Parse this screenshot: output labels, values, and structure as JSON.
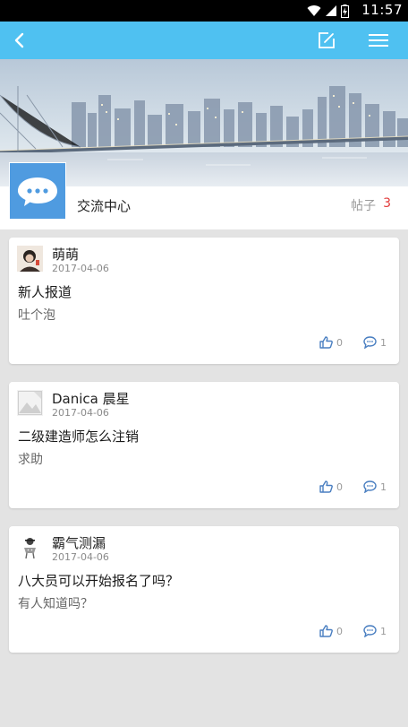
{
  "status_bar": {
    "time": "11:57"
  },
  "toolbar": {
    "back_icon": "back-arrow-icon",
    "edit_icon": "edit-icon",
    "menu_icon": "menu-icon"
  },
  "forum": {
    "name": "交流中心",
    "posts_label": "帖子",
    "posts_count": "3"
  },
  "colors": {
    "accent": "#4fc1f1",
    "count_red": "#e23b3b",
    "icon_blue": "#4a7fc1"
  },
  "posts": [
    {
      "author": "萌萌",
      "date": "2017-04-06",
      "title": "新人报道",
      "summary": "吐个泡",
      "likes": "0",
      "comments": "1"
    },
    {
      "author": "Danica 晨星",
      "date": "2017-04-06",
      "title": "二级建造师怎么注销",
      "summary": "求助",
      "likes": "0",
      "comments": "1"
    },
    {
      "author": "霸气测漏",
      "date": "2017-04-06",
      "title": "八大员可以开始报名了吗？",
      "summary": "有人知道吗？",
      "likes": "0",
      "comments": "1"
    }
  ]
}
